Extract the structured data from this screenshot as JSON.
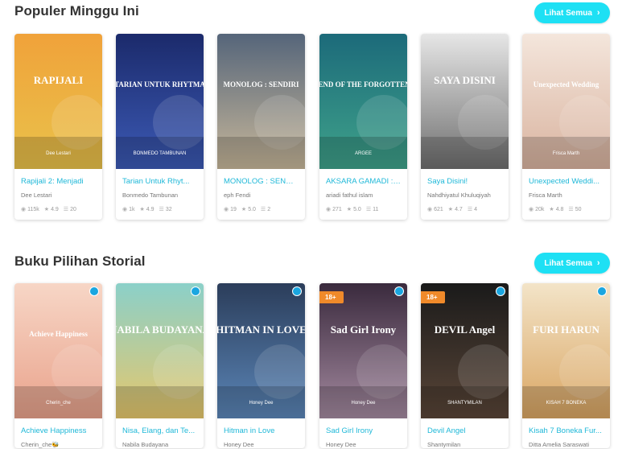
{
  "sections": [
    {
      "title": "Populer Minggu Ini",
      "see_all": "Lihat Semua",
      "books": [
        {
          "title": "Rapijali 2: Menjadi",
          "author": "Dee Lestari",
          "views": "115k",
          "rating": "4.9",
          "chapters": "20",
          "cover": {
            "bg1": "#f0a23a",
            "bg2": "#e9c24b",
            "text": "RAPIJALI",
            "sub": "Dee Lestari"
          }
        },
        {
          "title": "Tarian Untuk Rhyt...",
          "author": "Bonmedo Tambunan",
          "views": "1k",
          "rating": "4.9",
          "chapters": "32",
          "cover": {
            "bg1": "#1b2a6b",
            "bg2": "#3c5ab5",
            "text": "TARIAN UNTUK RHYTMA",
            "sub": "BONMEDO TAMBUNAN"
          }
        },
        {
          "title": "MONOLOG : SENDI...",
          "author": "eph Fendi",
          "views": "19",
          "rating": "5.0",
          "chapters": "2",
          "cover": {
            "bg1": "#55657a",
            "bg2": "#c7b79a",
            "text": "MONOLOG : SENDIRI",
            "sub": ""
          }
        },
        {
          "title": "AKSARA GAMADI : ...",
          "author": "ariadi fathul islam",
          "views": "271",
          "rating": "5.0",
          "chapters": "11",
          "cover": {
            "bg1": "#1c6a7a",
            "bg2": "#3fa28a",
            "text": "THE LEGEND OF THE FORGOTTEN FOREST",
            "sub": "ARGEE"
          }
        },
        {
          "title": "Saya Disini!",
          "author": "Nahdhiyatul Khuluqiyah",
          "views": "621",
          "rating": "4.7",
          "chapters": "4",
          "cover": {
            "bg1": "#e6e6e6",
            "bg2": "#6f6f6f",
            "text": "SAYA DISINI",
            "sub": ""
          }
        },
        {
          "title": "Unexpected Weddi...",
          "author": "Frisca Marth",
          "views": "20k",
          "rating": "4.8",
          "chapters": "50",
          "cover": {
            "bg1": "#f4e6dc",
            "bg2": "#d9b39f",
            "text": "Unexpected Wedding",
            "sub": "Frisca Marth"
          }
        }
      ]
    },
    {
      "title": "Buku Pilihan Storial",
      "see_all": "Lihat Semua",
      "books": [
        {
          "title": "Achieve Happiness",
          "author": "Cherin_che🐝",
          "badge": "",
          "cover": {
            "bg1": "#f7d6c6",
            "bg2": "#e9a28b",
            "text": "Achieve Happiness",
            "sub": "Cherin_che"
          }
        },
        {
          "title": "Nisa, Elang, dan Te...",
          "author": "Nabila Budayana",
          "badge": "",
          "cover": {
            "bg1": "#8bd0c9",
            "bg2": "#e7c76b",
            "text": "NABILA BUDAYANA",
            "sub": ""
          }
        },
        {
          "title": "Hitman in Love",
          "author": "Honey Dee",
          "badge": "",
          "cover": {
            "bg1": "#2b3d5a",
            "bg2": "#5b86b8",
            "text": "HITMAN IN LOVE",
            "sub": "Honey Dee"
          }
        },
        {
          "title": "Sad Girl Irony",
          "author": "Honey Dee",
          "badge": "18+",
          "cover": {
            "bg1": "#3a2a3d",
            "bg2": "#a48aa0",
            "text": "Sad Girl Irony",
            "sub": "Honey Dee"
          }
        },
        {
          "title": "Devil Angel",
          "author": "Shantymilan",
          "badge": "18+",
          "cover": {
            "bg1": "#1a1a1a",
            "bg2": "#5a4638",
            "text": "DEVIL Angel",
            "sub": "SHANTYMILAN"
          }
        },
        {
          "title": "Kisah 7 Boneka Fur...",
          "author": "Ditta Amelia Saraswati",
          "badge": "",
          "cover": {
            "bg1": "#f3e4c8",
            "bg2": "#d9a562",
            "text": "FURI HARUN",
            "sub": "KISAH 7 BONEKA"
          }
        }
      ]
    }
  ],
  "icons": {
    "views": "eye-icon",
    "rating": "star-icon",
    "chapters": "list-icon",
    "see_all": "chevron-right-icon"
  }
}
